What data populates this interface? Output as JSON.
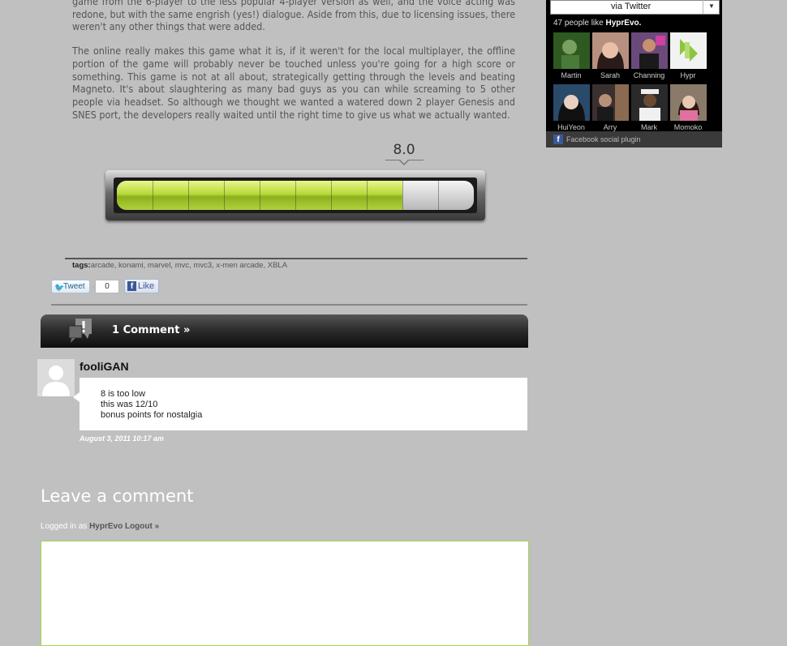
{
  "article": {
    "paragraph1": "game from the 6-player to the less popular 4-player version as well, and the voice acting was redone, but with the same engrish (yes!) dialogue. Aside from this, due to licensing issues, there weren't any other things that were added.",
    "paragraph2": "The online really makes this game what it is, if it weren't for the local multiplayer, the offline portion of the game will probably never be touched unless you're going for a high score or something. This game is not at all about, strategically getting through the levels and beating Magneto. It's about slaughtering as many bad guys as you can while screaming to 5 other people via headset. So although we thought we wanted a watered down 2 player Genesis and SNES port, the developers really waited until the right time to give us what we actually wanted."
  },
  "score": {
    "label": "8.0",
    "value": 8.0,
    "max": 10
  },
  "tags": {
    "prefix": "tags:",
    "list": "arcade, konami, marvel, mvc, mvc3, x-men arcade, XBLA"
  },
  "share": {
    "tweet_label": "Tweet",
    "tweet_count": "0",
    "like_label": "Like"
  },
  "comments": {
    "header": "1 Comment »",
    "items": [
      {
        "author": "fooliGAN",
        "lines": [
          "8 is too low",
          "this was 12/10",
          "bonus points for nostalgia"
        ],
        "date": "August 3, 2011 10:17 am"
      }
    ]
  },
  "leave_comment": {
    "title": "Leave a comment",
    "logged_in_prefix": "Logged in as",
    "username": "HyprEvo",
    "logout": "Logout »",
    "textarea_value": ""
  },
  "facebook": {
    "via": "via Twitter",
    "likes_count": "47 people like",
    "page_name": "HyprEvo.",
    "people": [
      {
        "name": "Martin",
        "color": "#3a6b2a"
      },
      {
        "name": "Sarah",
        "color": "#8a5a4a"
      },
      {
        "name": "Channing",
        "color": "#5a4a6a"
      },
      {
        "name": "Hypr",
        "color": "#f2f2f2"
      },
      {
        "name": "HuiYeon",
        "color": "#2a4a6a"
      },
      {
        "name": "Arry",
        "color": "#3a3a3a"
      },
      {
        "name": "Mark",
        "color": "#4a4a4a"
      },
      {
        "name": "Momoko",
        "color": "#6a5a4a"
      }
    ],
    "footer": "Facebook social plugin"
  }
}
